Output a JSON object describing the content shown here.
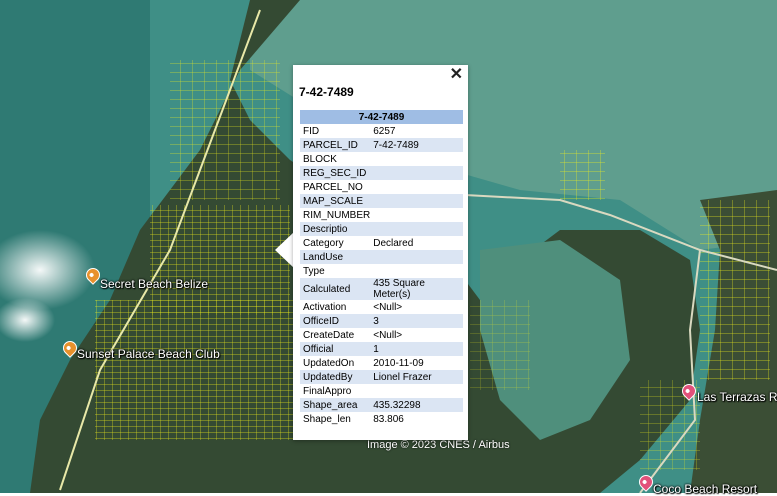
{
  "map": {
    "attribution": "Image © 2023 CNES / Airbus",
    "places": [
      {
        "name": "Secret Beach Belize",
        "pin_color": "#e8912c"
      },
      {
        "name": "Sunset Palace Beach Club",
        "pin_color": "#e8912c"
      },
      {
        "name": "Las Terrazas Re",
        "pin_color": "#e2517a"
      },
      {
        "name": "Coco Beach Resort",
        "pin_color": "#e2517a"
      }
    ],
    "colors": {
      "water": "#3f8f86",
      "land": "#344a33",
      "parcel_lines": "#f1f01a"
    }
  },
  "popup": {
    "close_glyph": "✕",
    "title": "7-42-7489",
    "table_header": "7-42-7489",
    "fields": [
      {
        "key": "FID",
        "value": "6257"
      },
      {
        "key": "PARCEL_ID",
        "value": "7-42-7489"
      },
      {
        "key": "BLOCK",
        "value": ""
      },
      {
        "key": "REG_SEC_ID",
        "value": ""
      },
      {
        "key": "PARCEL_NO",
        "value": ""
      },
      {
        "key": "MAP_SCALE",
        "value": ""
      },
      {
        "key": "RIM_NUMBER",
        "value": ""
      },
      {
        "key": "Descriptio",
        "value": ""
      },
      {
        "key": "Category",
        "value": "Declared"
      },
      {
        "key": "LandUse",
        "value": ""
      },
      {
        "key": "Type",
        "value": ""
      },
      {
        "key": "Calculated",
        "value": "435 Square Meter(s)"
      },
      {
        "key": "Activation",
        "value": "<Null>"
      },
      {
        "key": "OfficeID",
        "value": "3"
      },
      {
        "key": "CreateDate",
        "value": "<Null>"
      },
      {
        "key": "Official",
        "value": "1"
      },
      {
        "key": "UpdatedOn",
        "value": "2010-11-09"
      },
      {
        "key": "UpdatedBy",
        "value": "Lionel Frazer"
      },
      {
        "key": "FinalAppro",
        "value": ""
      },
      {
        "key": "Shape_area",
        "value": "435.32298"
      },
      {
        "key": "Shape_len",
        "value": "83.806"
      }
    ]
  }
}
